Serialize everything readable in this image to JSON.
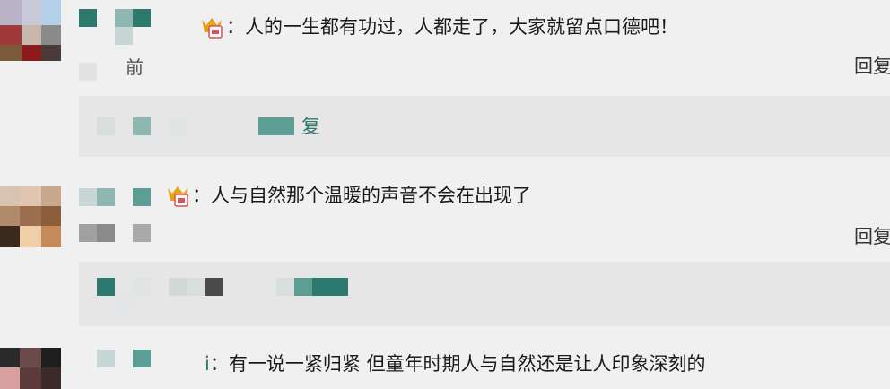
{
  "comments": [
    {
      "text": "人的一生都有功过，人都走了，大家就留点口德吧！",
      "time_partial": "前",
      "reply_label": "回复",
      "replies_link": "复"
    },
    {
      "text": "人与自然那个温暖的声音不会在出现了",
      "reply_label": "回复"
    },
    {
      "name_partial": "i",
      "text": "有一说一紧归紧 但童年时期人与自然还是让人印象深刻的"
    }
  ],
  "colors": {
    "accent_green": "#2c7a6e",
    "reply_box_bg": "#e6e6e6",
    "page_bg": "#f0f0f0"
  },
  "icons": [
    "vip-badge-icon"
  ]
}
